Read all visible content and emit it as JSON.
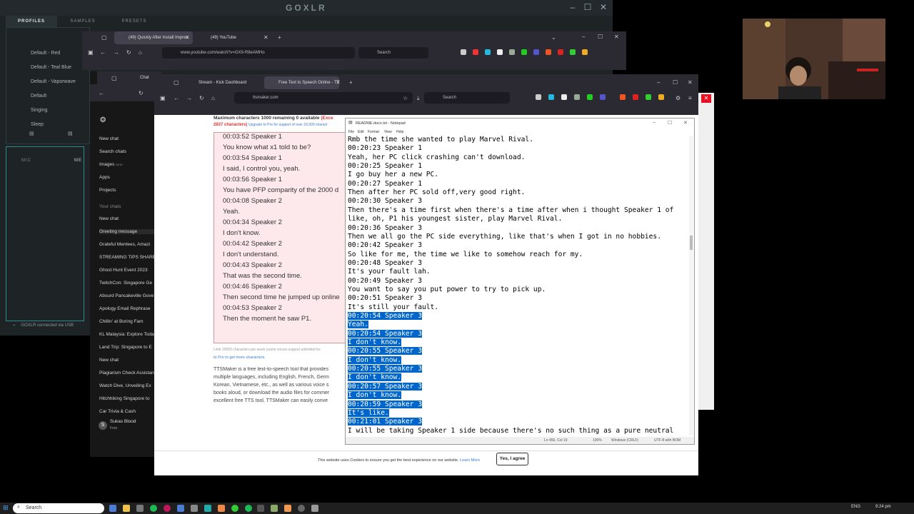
{
  "goxlr": {
    "logo": "GOXLR",
    "tabs": [
      "PROFILES",
      "SAMPLES",
      "PRESETS"
    ],
    "profiles": [
      "Default - Red",
      "Default - Teal Blue",
      "Default - Vaporwave",
      "Default",
      "Singing",
      "Sleep"
    ],
    "mic_tab": "MIC",
    "mic_tab_2": "ME",
    "status": "GOXLR connected via USB"
  },
  "yt_browser": {
    "tabs": [
      "(49) Quickly After Install Impres",
      "(49) YouTube"
    ],
    "url": "www.youtube.com/watch?v=GX9-R8eAMHo",
    "search_placeholder": "Search"
  },
  "chat_app": {
    "back_tab": "Chat",
    "items": [
      "New chat",
      "Search chats",
      "Images",
      "Apps",
      "Projects"
    ],
    "images_badge": "NEW",
    "section": "Your chats",
    "chats": [
      "New chat",
      "Greeting message",
      "Grateful Mentees, Amazi",
      "STREAMING TIPS SHARE",
      "Ghost Hunt Event 2023",
      "TwitchCon: Singapore Ge",
      "Absurd Pancakeville Gove",
      "Apology Email Rephrase",
      "Chillin' at Boring Fam",
      "KL Malaysia: Explore Toda",
      "Land Trip: Singapore to E",
      "New chat",
      "Plagiarism Check Assistan",
      "Watch Dive, Unveiling Ex",
      "Hitchhiking Singapore to",
      "Car Trivia & Cash"
    ],
    "user_name": "Sukas Blood",
    "user_plan": "Free",
    "user_initial": "S"
  },
  "tts_browser": {
    "tabs": [
      "Stream - Kick Dashboard",
      "Free Text to Speech Online - TT"
    ],
    "url": "ttsmaker.com",
    "search_placeholder": "Search",
    "limit_text": "Maximum characters 1000 remaining 0 available",
    "limit_exceeded": "(Exce",
    "count_text": "2837 characters)",
    "upgrade_text": "Upgrade to Pro for support of over 20,000 charact",
    "lines": [
      "00:03:52 Speaker 1",
      "You know what x1 told to be?",
      "00:03:54 Speaker 1",
      "I said, I control you, yeah.",
      "00:03:56 Speaker 1",
      "You have PFP comparity of the 2000 d",
      "00:04:08 Speaker 2",
      "Yeah.",
      "00:04:34 Speaker 2",
      "I don't know.",
      "00:04:42 Speaker 2",
      "I don't understand.",
      "00:04:43 Speaker 2",
      "That was the second time.",
      "00:04:46 Speaker 2",
      "Then second time he jumped up online",
      "00:04:53 Speaker 2",
      "Then the moment he saw P1."
    ],
    "limit_week": "Limit 20000 characters per week (some voices support unlimited fre",
    "pro_link": "to Pro to get more characters.",
    "desc_lines": [
      "TTSMaker is a free text-to-speech tool that provides",
      "multiple languages, including English, French, Germ",
      "Korean, Vietnamese, etc., as well as various voice s",
      "books aloud, or download the audio files for commer",
      "excellent free TTS tool, TTSMaker can easily conve"
    ],
    "cookie_text": "This website uses Cookies to ensure you get the best experience on our website.",
    "cookie_link": "Learn More",
    "cookie_button": "Yes, I agree"
  },
  "notepad": {
    "title": "README.docx.txt - Notepad",
    "menu": [
      "File",
      "Edit",
      "Format",
      "View",
      "Help"
    ],
    "lines": [
      {
        "text": "Rmb the time she wanted to play Marvel Rival.",
        "sel": false
      },
      {
        "text": "00:20:23 Speaker 1",
        "sel": false
      },
      {
        "text": "Yeah, her PC click crashing can't download.",
        "sel": false
      },
      {
        "text": "00:20:25 Speaker 1",
        "sel": false
      },
      {
        "text": "I go buy her a new PC.",
        "sel": false
      },
      {
        "text": "00:20:27 Speaker 1",
        "sel": false
      },
      {
        "text": "Then after her PC sold off,very good right.",
        "sel": false
      },
      {
        "text": "00:20:30 Speaker 3",
        "sel": false
      },
      {
        "text": "Then there's a time first when there's a time after when i thought Speaker 1 of",
        "sel": false
      },
      {
        "text": "like, oh, P1 his youngest sister, play Marvel Rival.",
        "sel": false
      },
      {
        "text": "00:20:36 Speaker 3",
        "sel": false
      },
      {
        "text": "Then we all go the PC side everything, like that's when I got in no hobbies.",
        "sel": false
      },
      {
        "text": "00:20:42 Speaker 3",
        "sel": false
      },
      {
        "text": "So like for me, the time we like to somehow reach for my.",
        "sel": false
      },
      {
        "text": "00:20:48 Speaker 3",
        "sel": false
      },
      {
        "text": "It's your fault lah.",
        "sel": false
      },
      {
        "text": "00:20:49 Speaker 3",
        "sel": false
      },
      {
        "text": "You want to say you put power to try to pick up.",
        "sel": false
      },
      {
        "text": "00:20:51 Speaker 3",
        "sel": false
      },
      {
        "text": "It's still your fault.",
        "sel": false
      },
      {
        "text": "00:20:54 Speaker 3",
        "sel": true
      },
      {
        "text": "Yeah.",
        "sel": true
      },
      {
        "text": "00:20:54 Speaker 3",
        "sel": true
      },
      {
        "text": "I don't know.",
        "sel": true
      },
      {
        "text": "00:20:55 Speaker 3",
        "sel": true
      },
      {
        "text": "I don't know.",
        "sel": true
      },
      {
        "text": "00:20:55 Speaker 3",
        "sel": true
      },
      {
        "text": "I don't know.",
        "sel": true
      },
      {
        "text": "00:20:57 Speaker 3",
        "sel": true
      },
      {
        "text": "I don't know.",
        "sel": true
      },
      {
        "text": "00:20:59 Speaker 3",
        "sel": true
      },
      {
        "text": "It's like.",
        "sel": true
      },
      {
        "text": "00:21:01 Speaker 3",
        "sel": true
      },
      {
        "text": "I will be taking Speaker 1 side because there's no such thing as a pure neutral",
        "sel": false
      }
    ],
    "status_pos": "Ln 456, Col 19",
    "status_zoom": "100%",
    "status_eol": "Windows (CRLF)",
    "status_enc": "UTF-8 with BOM"
  },
  "taskbar": {
    "search_placeholder": "Search",
    "lang": "ENG",
    "time": "9:24 pm"
  },
  "colors": {
    "selection": "#0066cc",
    "goxlr_accent": "#2c8a8a",
    "tts_box": "#fde8ec"
  }
}
